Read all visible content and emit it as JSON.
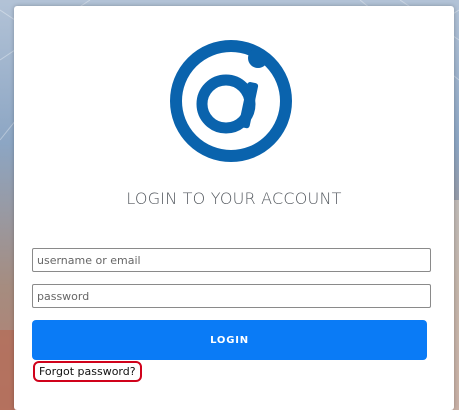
{
  "login": {
    "title": "LOGIN TO YOUR ACCOUNT",
    "username_placeholder": "username or email",
    "password_placeholder": "password",
    "login_label": "LOGIN",
    "forgot_label": "Forgot password?"
  },
  "logo": {
    "icon": "at-sign-logo-icon",
    "color": "#0a63ad"
  },
  "colors": {
    "accent": "#0a7bf6",
    "highlight": "#d0021b"
  }
}
